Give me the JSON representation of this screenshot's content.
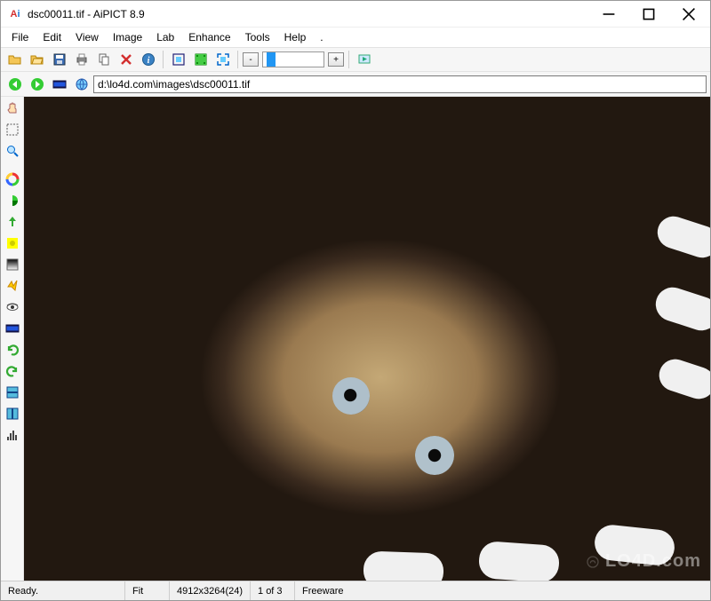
{
  "window": {
    "title": "dsc00011.tif - AiPICT 8.9"
  },
  "menu": {
    "items": [
      "File",
      "Edit",
      "View",
      "Image",
      "Lab",
      "Enhance",
      "Tools",
      "Help",
      "."
    ]
  },
  "toolbar1": {
    "icons": [
      "open-folder-icon",
      "browse-folder-icon",
      "save-icon",
      "print-icon",
      "copy-icon",
      "delete-icon",
      "info-icon",
      "fit-window-icon",
      "actual-size-icon",
      "fullscreen-icon"
    ],
    "minus": "-",
    "plus": "+",
    "slideshow_icon": "slideshow-icon"
  },
  "navbar": {
    "path_value": "d:\\lo4d.com\\images\\dsc00011.tif"
  },
  "side_toolbar": {
    "icons": [
      "hand-icon",
      "marquee-icon",
      "zoom-icon",
      "color-wheel-icon",
      "hue-icon",
      "export-up-icon",
      "brightness-icon",
      "gradient-icon",
      "auto-fix-icon",
      "redeye-icon",
      "film-icon",
      "undo-icon",
      "redo-icon",
      "split-h-icon",
      "split-v-icon",
      "histogram-icon"
    ]
  },
  "status": {
    "ready": "Ready.",
    "fit": "Fit",
    "dimensions": "4912x3264(24)",
    "index": "1 of 3",
    "license": "Freeware"
  },
  "watermark": {
    "text": "LO4D.com"
  },
  "colors": {
    "accent": "#2196f3"
  }
}
